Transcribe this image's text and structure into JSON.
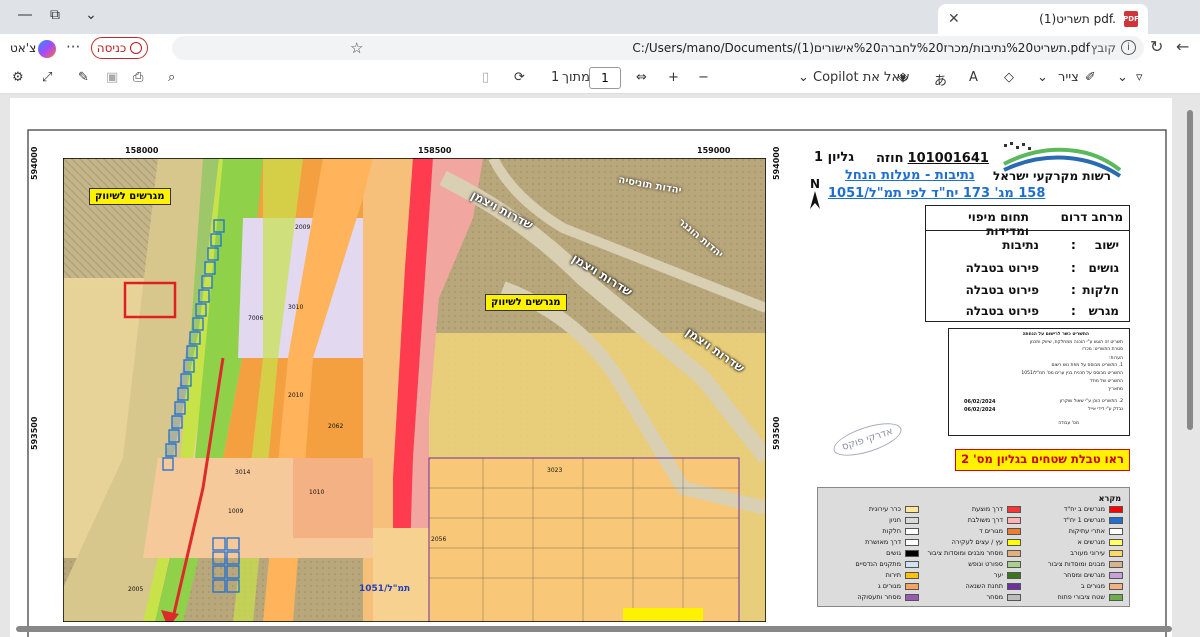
{
  "browser": {
    "tab_title": "(1)תשריט pdf.",
    "pdf_icon_label": "PDF",
    "url_label": "קובץ",
    "url": "C:/Users/mano/Documents/(1)תשריט%20נתיבות/מכרז%20לחברה%20אישורים.pdf",
    "login_label": "כניסה",
    "chat_label": "צ'אט"
  },
  "toolbar": {
    "copilot_label": "שאל את Copilot",
    "draw_label": "צייר",
    "page_current": "1",
    "page_of_label": "מתוך",
    "page_total": "1"
  },
  "document": {
    "header": {
      "org_name": "רשות מקרקעי ישראל",
      "sheet_label": "גליון 1",
      "contract_prefix": "חוזה",
      "contract_number": "101001641",
      "project_name": "נתיבות - מעלות הנחל",
      "plan_ref": "158 מג' 173 יח\"ד לפי תמ\"ל/1051",
      "north": "N"
    },
    "region": {
      "district": "מרחב דרום",
      "department": "תחום מיפוי ומדידות"
    },
    "fields": [
      {
        "label": "ישוב",
        "value": "נתיבות"
      },
      {
        "label": "גושים",
        "value": "פירוט בטבלה"
      },
      {
        "label": "חלקות",
        "value": "פירוט בטבלה"
      },
      {
        "label": "מגרש",
        "value": "פירוט בטבלה"
      }
    ],
    "notes": {
      "title": "התשריט כשר לרישום על הנחתה",
      "line1": "תשריט זה הוגש ע\"י הוכנה ממחלקת, שיווק ותכנון",
      "line2": "סטרת התשריט: מכרז",
      "line3": "הערות:",
      "line4": "1. התשריט מבוסס על מפת נוש רשום",
      "line5": "התשריט מבוסס על תכנית בנין ערים מס' תמ\"ל/1051",
      "line6": "התשריט של מודד",
      "line7": "מתאריך",
      "line8": "2. התשריט הוכן ע\"י שאול שוקרון",
      "line9": "נבדק ע\"י דידי אייל",
      "date1": "06/02/2024",
      "date2": "06/02/2024",
      "line10": "מס' עבודה"
    },
    "stamp": "אדרקי פוקס",
    "see_table": "ראו טבלת שטחים בגליון מס' 2",
    "map": {
      "x_coords": [
        "158000",
        "158500",
        "159000"
      ],
      "y_coords": [
        "594000",
        "593500"
      ],
      "callouts": [
        "מגרשים לשיווק",
        "מגרשים לשיווק"
      ],
      "streets": [
        "שדרות ויצמן",
        "שדרות ויצמן",
        "שדרות ויצמן",
        "יהדות תוניסיה",
        "יהדות הונגר"
      ],
      "plan_label": "תמ\"ל/1051"
    },
    "legend": {
      "title": "מקרא",
      "items": [
        {
          "label": "מגרשים ב יח\"ד",
          "color": "#ff0000"
        },
        {
          "label": "מגרשים 1 יח\"ד",
          "color": "#1f6fd1"
        },
        {
          "label": "אתרי עתיקות",
          "color": "#ffffff"
        },
        {
          "label": "מגרשים א",
          "color": "#ffff66"
        },
        {
          "label": "עירוני מעורב",
          "color": "#ffd966"
        },
        {
          "label": "מבנים ומוסדות ציבור",
          "color": "#d9b38c"
        },
        {
          "label": "מגרשים ומסחר",
          "color": "#c9a0dc"
        },
        {
          "label": "מגורים ב",
          "color": "#f4b183"
        },
        {
          "label": "שטח ציבורי פתוח",
          "color": "#70ad47"
        },
        {
          "label": "דרך מוצעת",
          "color": "#ff3333"
        },
        {
          "label": "דרך משולבת",
          "color": "#ffb3b3"
        },
        {
          "label": "מגורים ד",
          "color": "#ed7d31"
        },
        {
          "label": "עץ / עצים לעקירה",
          "color": "#ffff00"
        },
        {
          "label": "מסחר מבנים ומוסדות ציבור",
          "color": "#e2b07e"
        },
        {
          "label": "ספורט ונופש",
          "color": "#a9d18e"
        },
        {
          "label": "יער",
          "color": "#38761d"
        },
        {
          "label": "תחנת השנאה",
          "color": "#7030a0"
        },
        {
          "label": "מסחר",
          "color": "#bdbdbd"
        },
        {
          "label": "כרר עירונית",
          "color": "#ffe699"
        },
        {
          "label": "חניון",
          "color": "#d9d9d9"
        },
        {
          "label": "חלקות",
          "color": "#ffffff"
        },
        {
          "label": "דרך מאושרת",
          "color": "#ffffff"
        },
        {
          "label": "גושים",
          "color": "#000000"
        },
        {
          "label": "מתקנים הנדסיים",
          "color": "#cfe2f3"
        },
        {
          "label": "תירות",
          "color": "#ffc000"
        },
        {
          "label": "מגורים ג",
          "color": "#f4a460"
        },
        {
          "label": "מסחר ותעסוקה",
          "color": "#9b59b6"
        }
      ]
    }
  }
}
